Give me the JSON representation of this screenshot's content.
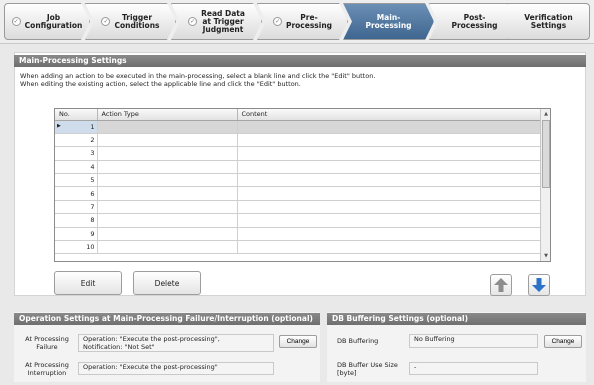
{
  "wizard": {
    "steps": [
      {
        "label": "Job\nConfiguration",
        "checked": true
      },
      {
        "label": "Trigger\nConditions",
        "checked": true
      },
      {
        "label": "Read Data\nat Trigger\nJudgment",
        "checked": true
      },
      {
        "label": "Pre-\nProcessing",
        "checked": true
      },
      {
        "label": "Main-\nProcessing",
        "active": true
      },
      {
        "label": "Post-\nProcessing"
      },
      {
        "label": "Verification\nSettings"
      }
    ]
  },
  "main_processing": {
    "title": "Main-Processing Settings",
    "description": "When adding an action to be executed in the main-processing, select a blank line and click the \"Edit\" button.\nWhen editing the existing action, select the applicable line and click the \"Edit\" button.",
    "columns": [
      "No.",
      "Action Type",
      "Content"
    ],
    "rows": [
      "1",
      "2",
      "3",
      "4",
      "5",
      "6",
      "7",
      "8",
      "9",
      "10"
    ],
    "selected_row": "1",
    "edit_label": "Edit",
    "delete_label": "Delete"
  },
  "failure_settings": {
    "title": "Operation Settings at Main-Processing Failure/Interruption (optional)",
    "failure_label": "At Processing\nFailure",
    "failure_value": "Operation: \"Execute the post-processing\",\nNotification: \"Not Set\"",
    "change_label": "Change",
    "interruption_label": "At Processing\nInterruption",
    "interruption_value": "Operation: \"Execute the post-processing\""
  },
  "db_buffering": {
    "title": "DB Buffering Settings (optional)",
    "buffering_label": "DB Buffering",
    "buffering_value": "No Buffering",
    "change_label": "Change",
    "use_size_label": "DB Buffer Use Size\n[byte]",
    "use_size_value": "-"
  },
  "colors": {
    "active_step": "#4a7098",
    "arrow_up": "#8d8d8d",
    "arrow_down": "#2c73c7"
  }
}
